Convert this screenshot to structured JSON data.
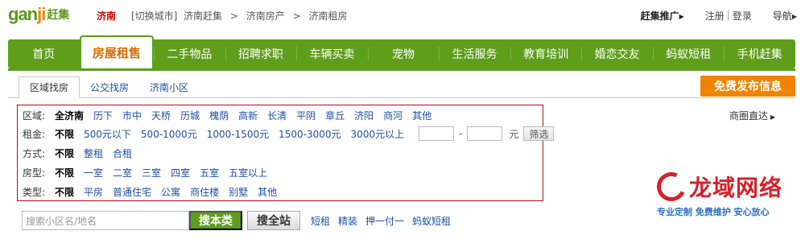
{
  "header": {
    "logo_text": "ganji",
    "logo_cn": "赶集",
    "city": "济南",
    "switch_city": "[切换城市]",
    "breadcrumb": [
      "济南赶集",
      "济南房产",
      "济南租房"
    ],
    "breadcrumb_sep": ">",
    "promo": "赶集推广",
    "register": "注册",
    "login": "登录",
    "sep": "|",
    "nav": "导航"
  },
  "navbar": {
    "items": [
      "首页",
      "房屋租售",
      "二手物品",
      "招聘求职",
      "车辆买卖",
      "宠物",
      "生活服务",
      "教育培训",
      "婚恋交友",
      "蚂蚁短租",
      "手机赶集"
    ],
    "active": "房屋租售"
  },
  "tabs": [
    "区域找房",
    "公交找房",
    "济南小区"
  ],
  "publish_button": "免费发布信息",
  "shangquan": "商圈直达",
  "filters": {
    "area": {
      "label": "区域:",
      "options": [
        "全济南",
        "历下",
        "市中",
        "天桥",
        "历城",
        "槐荫",
        "高新",
        "长清",
        "平阴",
        "章丘",
        "济阳",
        "商河",
        "其他"
      ]
    },
    "rent": {
      "label": "租金:",
      "options": [
        "不限",
        "500元以下",
        "500-1000元",
        "1000-1500元",
        "1500-3000元",
        "3000元以上"
      ],
      "dash": "-",
      "unit": "元",
      "button": "筛选"
    },
    "method": {
      "label": "方式:",
      "options": [
        "不限",
        "整租",
        "合租"
      ]
    },
    "room": {
      "label": "房型:",
      "options": [
        "不限",
        "一室",
        "二室",
        "三室",
        "四室",
        "五室",
        "五室以上"
      ]
    },
    "type": {
      "label": "类型:",
      "options": [
        "不限",
        "平房",
        "普通住宅",
        "公寓",
        "商住楼",
        "别墅",
        "其他"
      ]
    }
  },
  "search": {
    "placeholder": "搜索小区名/地名",
    "local_button": "搜本类",
    "all_button": "搜全站",
    "quick_links": [
      "短租",
      "精装",
      "押一付一",
      "蚂蚁短租"
    ]
  },
  "watermark": {
    "title": "龙域网络",
    "subtitle": "专业定制 免费维护 安心放心"
  },
  "colors": {
    "brand_green": "#5e9e1b",
    "accent_orange": "#f08300",
    "link_blue": "#1d50a6",
    "filter_border": "#b20e1e"
  }
}
